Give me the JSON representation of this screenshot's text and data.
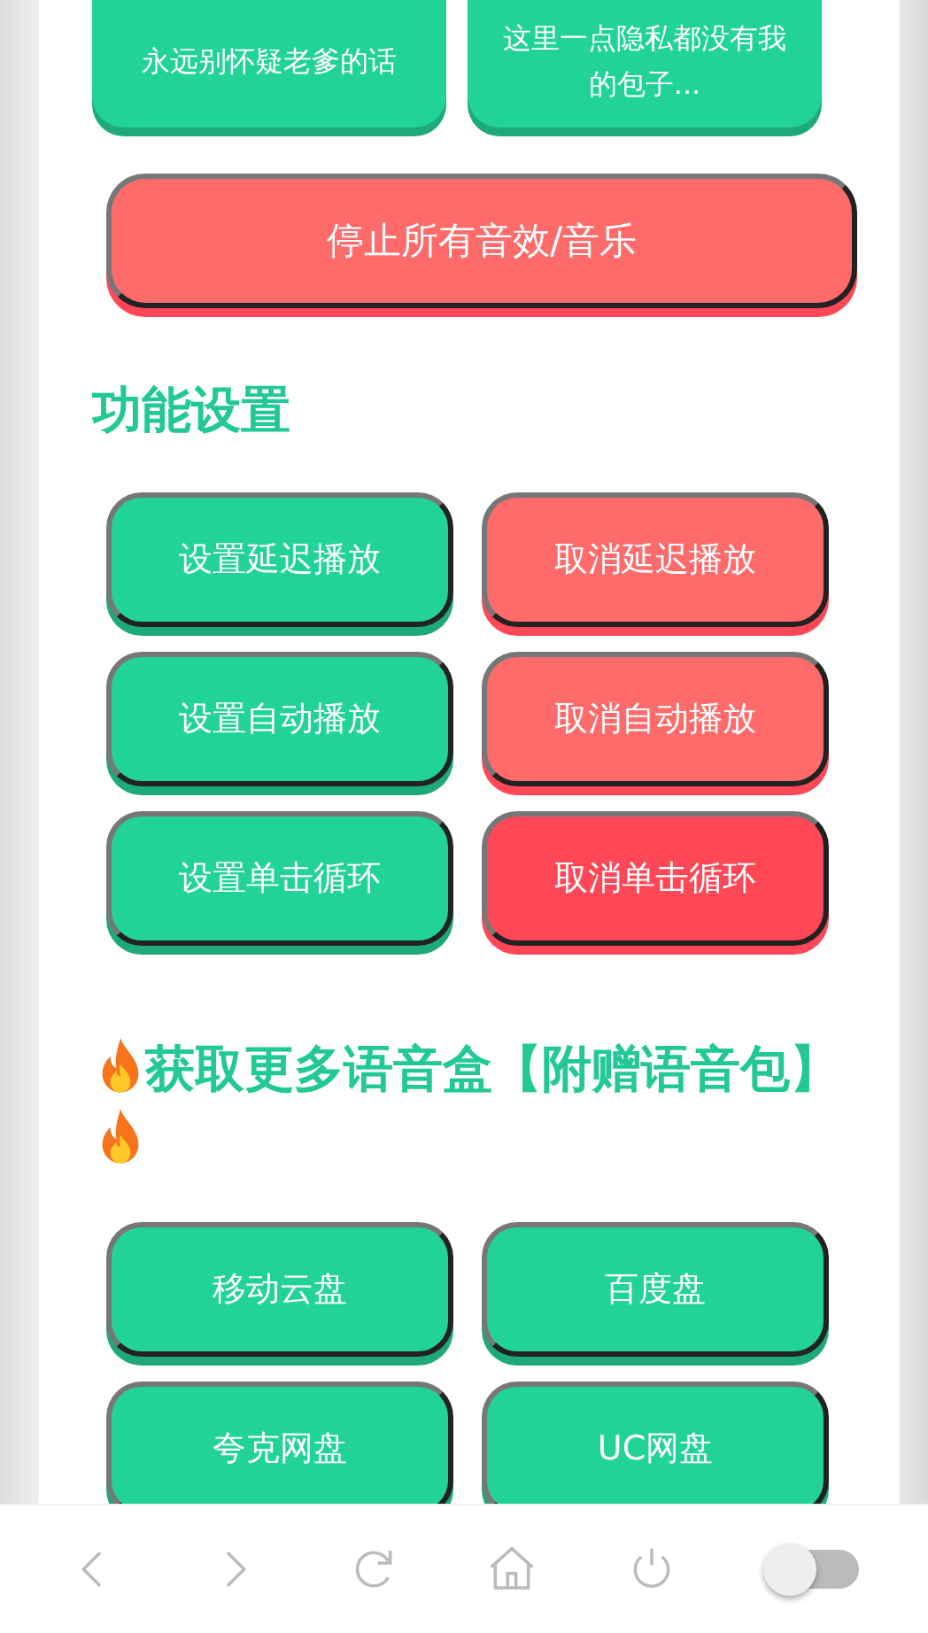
{
  "top_buttons": [
    {
      "label": "永远别怀疑老爹的话"
    },
    {
      "label": "这里一点隐私都没有我的包子..."
    }
  ],
  "stop_button": {
    "label": "停止所有音效/音乐"
  },
  "settings": {
    "title": "功能设置",
    "buttons": [
      {
        "label": "设置延迟播放",
        "color": "#22d399"
      },
      {
        "label": "取消延迟播放",
        "color": "#ff6b6b"
      },
      {
        "label": "设置自动播放",
        "color": "#22d399"
      },
      {
        "label": "取消自动播放",
        "color": "#ff6b6b"
      },
      {
        "label": "设置单击循环",
        "color": "#22d399"
      },
      {
        "label": "取消单击循环",
        "color": "#ff4757"
      }
    ]
  },
  "more": {
    "title": "获取更多语音盒【附赠语音包】",
    "buttons": [
      {
        "label": "移动云盘",
        "color": "#22d399"
      },
      {
        "label": "百度盘",
        "color": "#22d399"
      },
      {
        "label": "夸克网盘",
        "color": "#22d399"
      },
      {
        "label": "UC网盘",
        "color": "#22d399"
      }
    ]
  },
  "bottom_bar": {
    "toggle": {
      "on": false
    }
  }
}
